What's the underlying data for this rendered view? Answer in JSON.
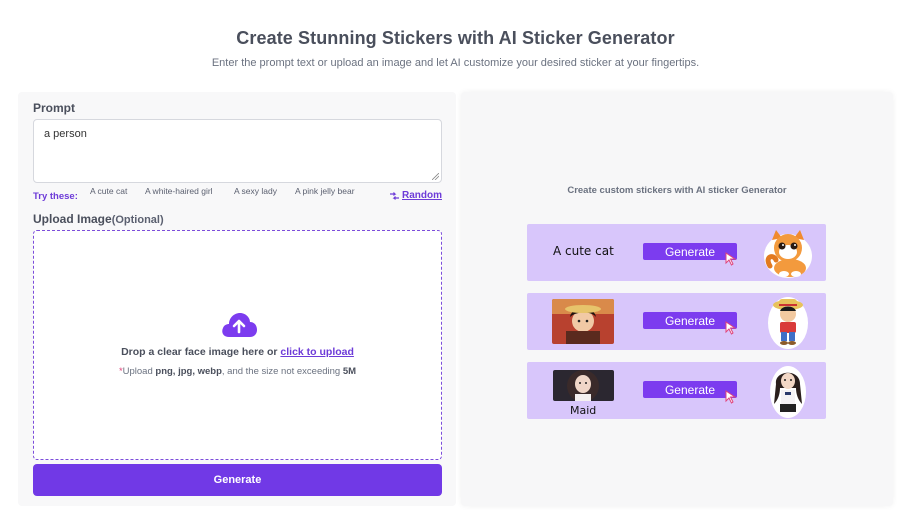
{
  "header": {
    "title": "Create Stunning Stickers with AI Sticker Generator",
    "subtitle": "Enter the prompt text or upload an image and let AI customize your desired sticker at your fingertips."
  },
  "form": {
    "prompt_label": "Prompt",
    "prompt_value": "a person",
    "try_label": "Try these:",
    "suggestions": [
      "A cute cat",
      "A white-haired girl",
      "A sexy lady",
      "A pink jelly bear"
    ],
    "random_label": "Random",
    "upload_label": "Upload Image",
    "upload_optional": "(Optional)",
    "drop_text": "Drop a clear face image here or ",
    "drop_link": "click to upload",
    "hint_star": "*",
    "hint_prefix": "Upload ",
    "hint_formats": "png, jpg, webp",
    "hint_middle": ", and the size not exceeding ",
    "hint_size": "5M",
    "generate_label": "Generate"
  },
  "promo": {
    "title": "Create custom stickers with AI sticker Generator",
    "cards": [
      {
        "text": "A cute cat",
        "button": "Generate",
        "sticker": "cat-sticker"
      },
      {
        "text": "",
        "button": "Generate",
        "sticker": "pirate-sticker",
        "thumb": "anime-boy-photo"
      },
      {
        "text": "Maid",
        "button": "Generate",
        "sticker": "maid-sticker",
        "thumb": "maid-photo"
      }
    ]
  },
  "colors": {
    "accent": "#7139e6",
    "card_bg": "#d8c6fb",
    "card_button": "#7c3cef",
    "hint_star": "#e0457b"
  }
}
